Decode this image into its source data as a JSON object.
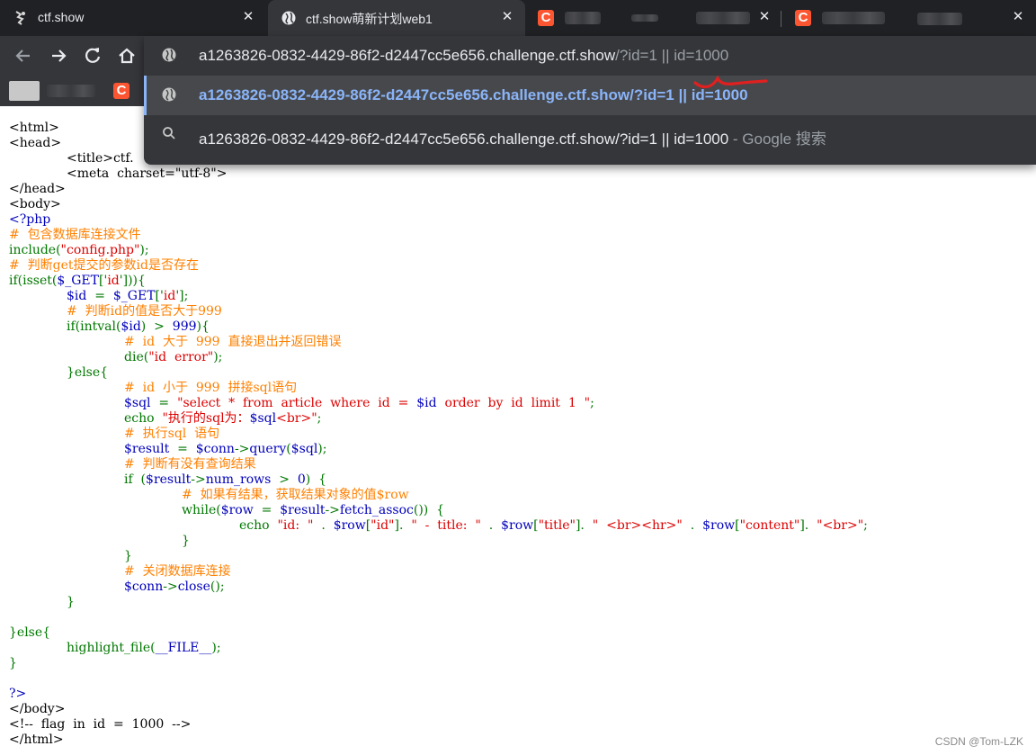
{
  "tabs": [
    {
      "title": "ctf.show",
      "icon": "ctf-logo-icon"
    },
    {
      "title": "ctf.show萌新计划web1",
      "icon": "globe-icon"
    },
    {
      "title": "",
      "icon": "csdn-icon"
    },
    {
      "title": "",
      "icon": "csdn-icon"
    }
  ],
  "close_label": "✕",
  "address": {
    "host": "a1263826-0832-4429-86f2-d2447cc5e656.challenge.ctf.show",
    "path": "/?id=1 || id=1000"
  },
  "suggestions": [
    {
      "url": "a1263826-0832-4429-86f2-d2447cc5e656.challenge.ctf.show/?id=1 || id=1000",
      "suffix": ""
    },
    {
      "url": "a1263826-0832-4429-86f2-d2447cc5e656.challenge.ctf.show/?id=1 || id=1000",
      "suffix": " - Google 搜索"
    }
  ],
  "source": {
    "l01": "<html>",
    "l02": "<head>",
    "l03": "<title>ctf.",
    "l04": "<meta  charset=\"utf-8\">",
    "l05": "</head>",
    "l06": "<body>",
    "l07": "<?php",
    "l08": "#  包含数据库连接文件",
    "l09a": "include(",
    "l09b": "\"config.php\"",
    "l09c": ");",
    "l10": "#  判断get提交的参数id是否存在",
    "l11a": "if(isset(",
    "l11b": "$_GET",
    "l11c": "['",
    "l11d": "id",
    "l11e": "'])){",
    "l12a": "$id",
    "l12b": "  =  ",
    "l12c": "$_GET",
    "l12d": "['",
    "l12e": "id",
    "l12f": "'];",
    "l13": "#  判断id的值是否大于999",
    "l14a": "if(intval(",
    "l14b": "$id",
    "l14c": ")  >  ",
    "l14d": "999",
    "l14e": "){",
    "l15": "#  id  大于  999  直接退出并返回错误",
    "l16a": "die(",
    "l16b": "\"id  error\"",
    "l16c": ");",
    "l17": "}else{",
    "l18": "#  id  小于  999  拼接sql语句",
    "l19a": "$sql",
    "l19b": "  =  ",
    "l19c": "\"select  *  from  article  where  id  =  ",
    "l19d": "$id",
    "l19e": "  order  by  id  limit  1  \"",
    "l19f": ";",
    "l20a": "echo  ",
    "l20b": "\"执行的sql为：",
    "l20c": "$sql",
    "l20d": "<br>\"",
    "l20e": ";",
    "l21": "#  执行sql  语句",
    "l22a": "$result",
    "l22b": "  =  ",
    "l22c": "$conn",
    "l22d": "->",
    "l22e": "query",
    "l22f": "(",
    "l22g": "$sql",
    "l22h": ");",
    "l23": "#  判断有没有查询结果",
    "l24a": "if  (",
    "l24b": "$result",
    "l24c": "->",
    "l24d": "num_rows",
    "l24e": "  >  ",
    "l24f": "0",
    "l24f2": ")  {",
    "l25": "#  如果有结果，获取结果对象的值$row",
    "l26a": "while(",
    "l26b": "$row",
    "l26c": "  =  ",
    "l26d": "$result",
    "l26e": "->",
    "l26f": "fetch_assoc",
    "l26g": "())  {",
    "l27a": "echo  ",
    "l27b": "\"id:  \"",
    "l27c": "  .  ",
    "l27d": "$row",
    "l27e": "[",
    "l27f": "\"id\"",
    "l27g": "].  ",
    "l27h": "\"  -  title:  \"",
    "l27i": "  .  ",
    "l27j": "$row",
    "l27k": "[",
    "l27l": "\"title\"",
    "l27m": "].  ",
    "l27n": "\"  <br><hr>\"",
    "l27o": "  .  ",
    "l27p": "$row",
    "l27q": "[",
    "l27r": "\"content\"",
    "l27s": "].  ",
    "l27t": "\"<br>\"",
    "l27u": ";",
    "l28": "}",
    "l29": "}",
    "l30": "#  关闭数据库连接",
    "l31a": "$conn",
    "l31b": "->",
    "l31c": "close",
    "l31d": "();",
    "l32": "}",
    "l34": "}else{",
    "l35a": "highlight_file(",
    "l35b": "__FILE__",
    "l35c": ");",
    "l36": "}",
    "l38": "?>",
    "l39": "</body>",
    "l40": "<!--  flag  in  id  =  1000  -->",
    "l41": "</html>"
  },
  "watermark": "CSDN @Tom-LZK",
  "colors": {
    "comment": "#ff8000",
    "keyword": "#007700",
    "string": "#dd0000",
    "variable": "#0000bb",
    "accent": "#8ab4f8"
  }
}
